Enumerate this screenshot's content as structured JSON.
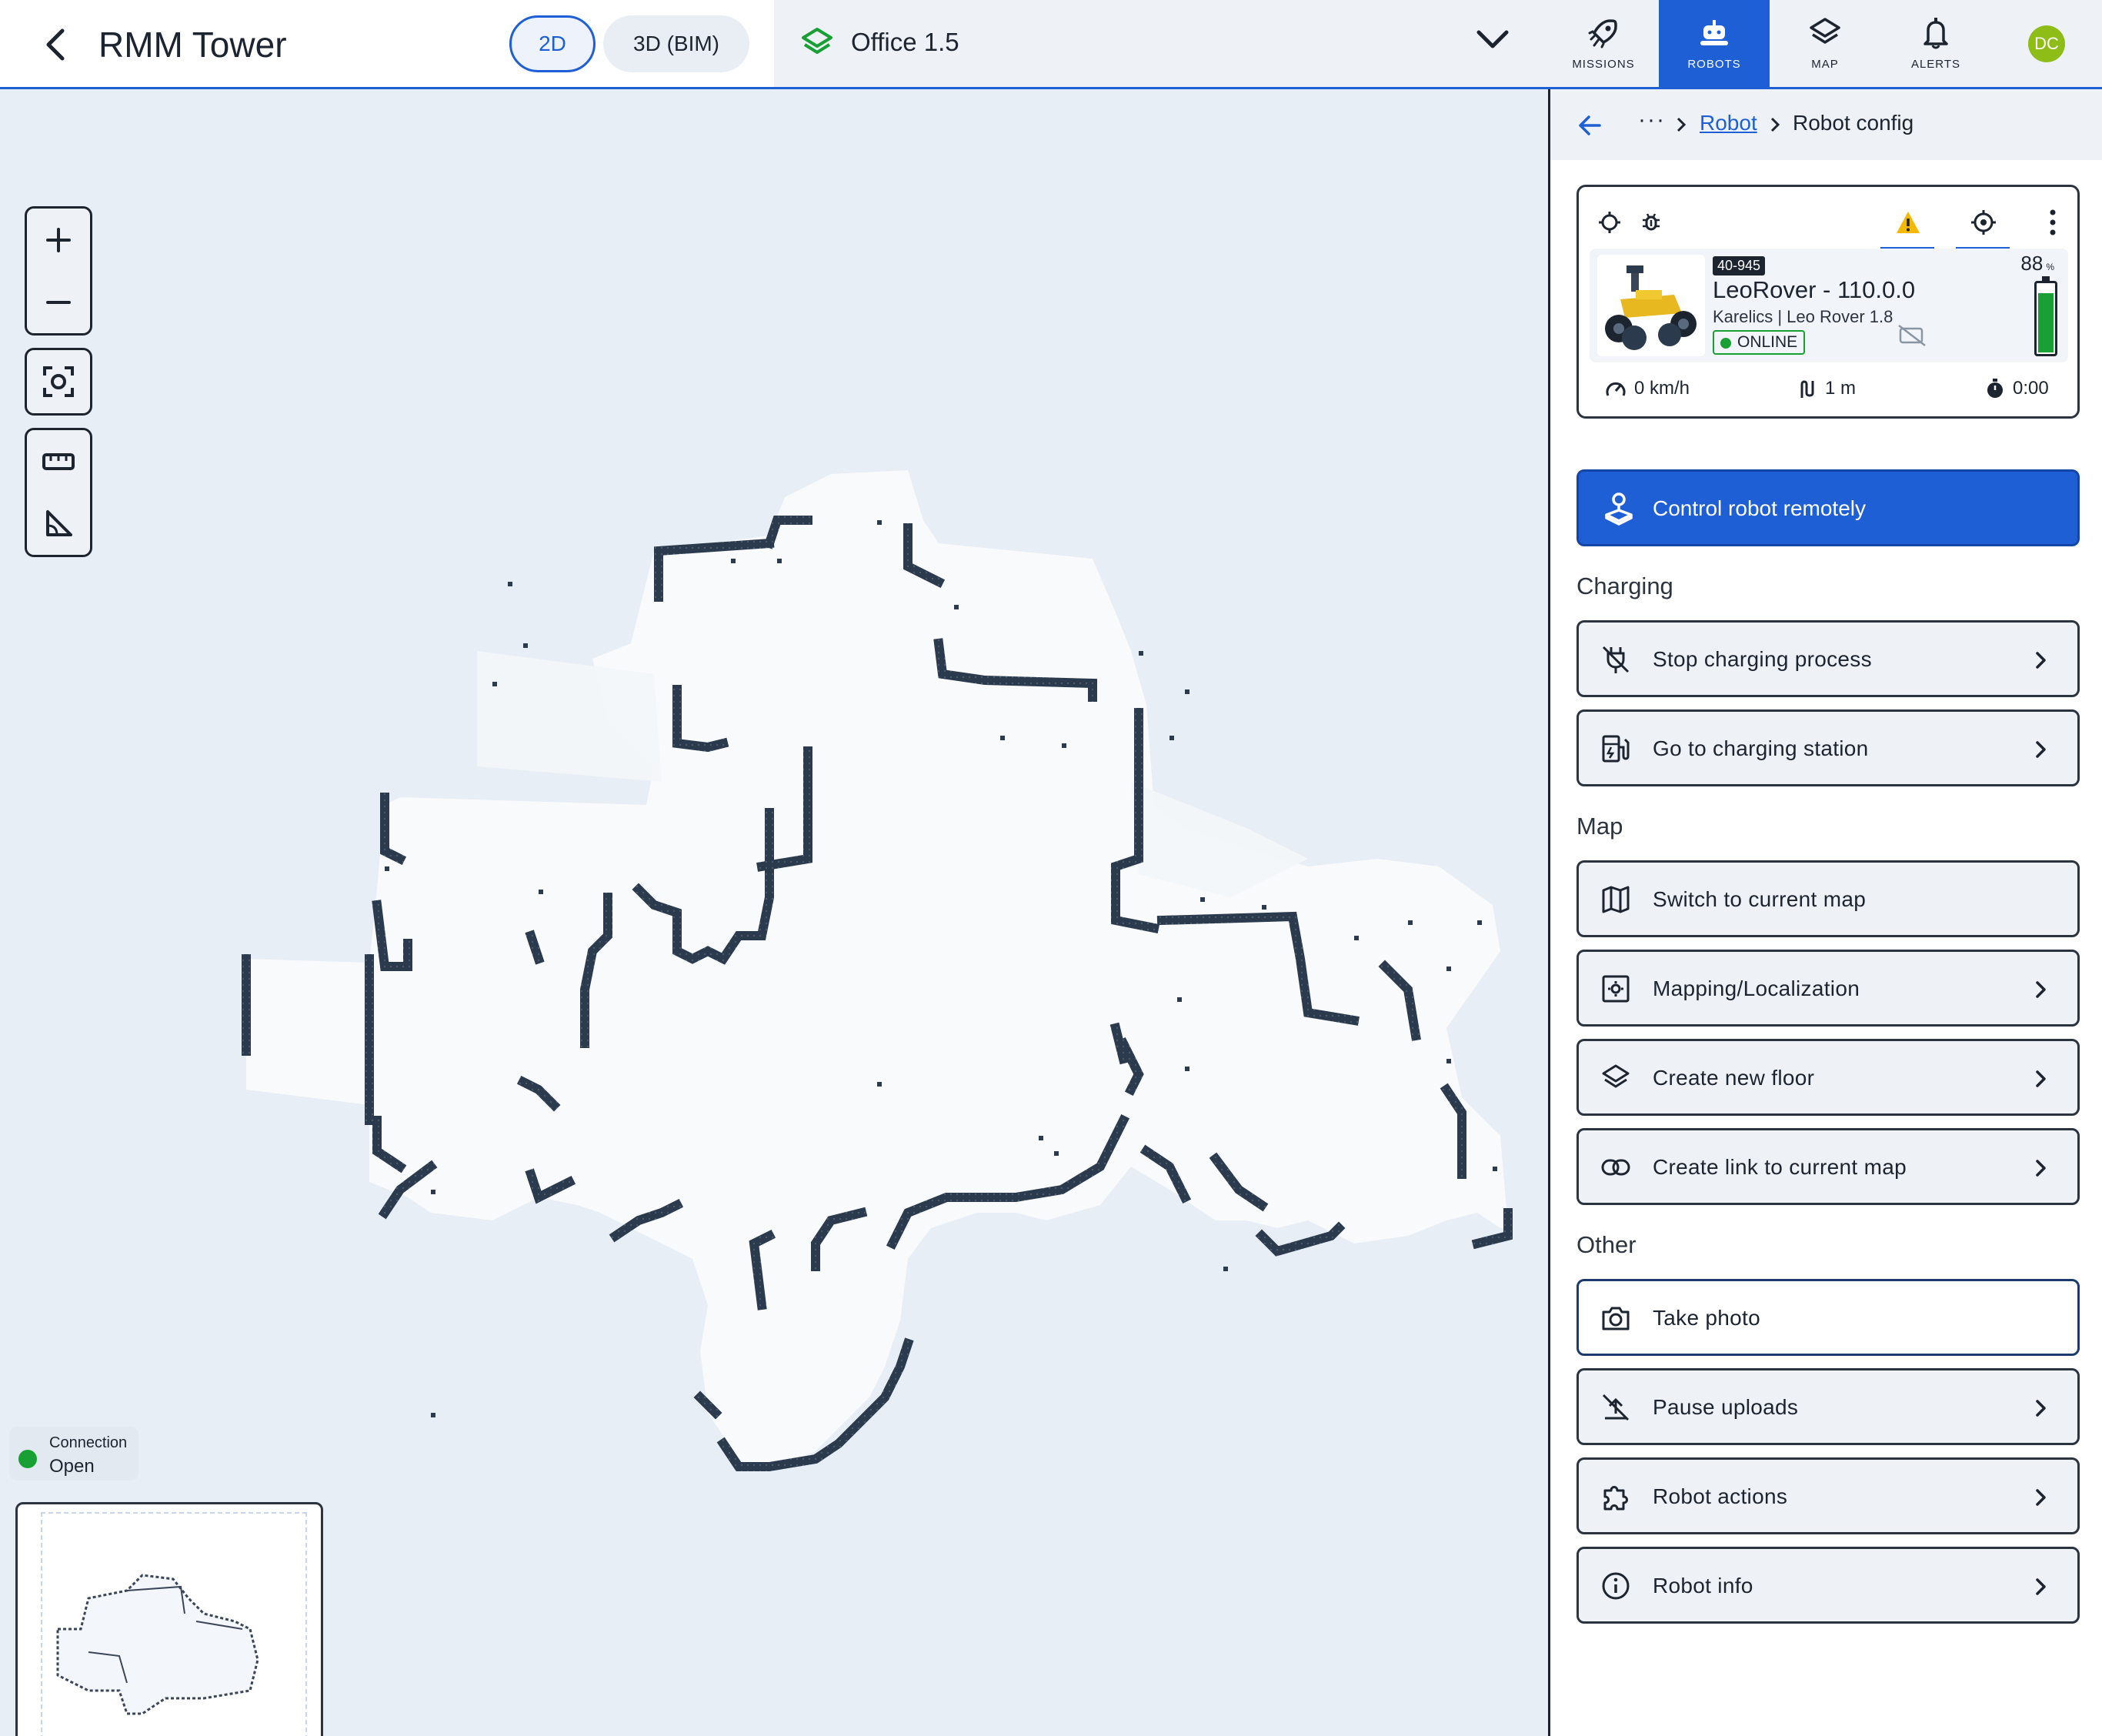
{
  "header": {
    "title": "RMM Tower",
    "view_2d": "2D",
    "view_3d": "3D (BIM)",
    "floor": "Office 1.5"
  },
  "nav": {
    "items": [
      {
        "label": "MISSIONS",
        "icon": "rocket-icon",
        "active": false
      },
      {
        "label": "ROBOTS",
        "icon": "robot-icon",
        "active": true
      },
      {
        "label": "MAP",
        "icon": "layers-icon",
        "active": false
      },
      {
        "label": "ALERTS",
        "icon": "bell-icon",
        "active": false
      }
    ],
    "avatar_initials": "DC",
    "avatar_color": "#8fbd18"
  },
  "map": {
    "connection_label": "Connection",
    "connection_status": "Open"
  },
  "panel": {
    "breadcrumb_more": "···",
    "breadcrumb_link": "Robot",
    "breadcrumb_current": "Robot config",
    "robot": {
      "id": "40-945",
      "name": "LeoRover - 110.0.0",
      "model": "Karelics | Leo Rover 1.8",
      "status": "ONLINE",
      "battery": "88",
      "battery_unit": "%",
      "battery_fraction": 0.88,
      "speed": "0 km/h",
      "distance": "1 m",
      "time": "0:00"
    },
    "control_button": "Control robot remotely",
    "sections": {
      "charging": "Charging",
      "map": "Map",
      "other": "Other"
    },
    "actions": {
      "stop_charging": "Stop charging process",
      "go_charging": "Go to charging station",
      "switch_map": "Switch to current map",
      "mapping": "Mapping/Localization",
      "new_floor": "Create new floor",
      "link_map": "Create link to current map",
      "take_photo": "Take photo",
      "pause_uploads": "Pause uploads",
      "robot_actions": "Robot actions",
      "robot_info": "Robot info"
    }
  },
  "colors": {
    "accent": "#1f5fd6",
    "online": "#18a034",
    "warning": "#f5b800",
    "map_wall": "#2b3a4c"
  }
}
